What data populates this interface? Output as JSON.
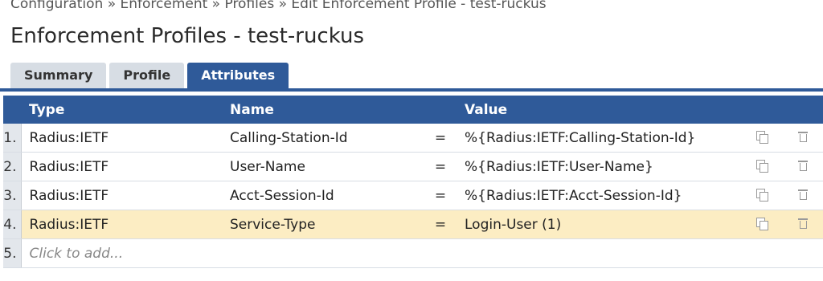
{
  "breadcrumb": "Configuration » Enforcement » Profiles » Edit Enforcement Profile - test-ruckus",
  "page_title": "Enforcement Profiles - test-ruckus",
  "tabs": [
    {
      "label": "Summary",
      "active": false
    },
    {
      "label": "Profile",
      "active": false
    },
    {
      "label": "Attributes",
      "active": true
    }
  ],
  "table": {
    "headers": {
      "type": "Type",
      "name": "Name",
      "value": "Value"
    },
    "rows": [
      {
        "num": "1.",
        "type": "Radius:IETF",
        "name": "Calling-Station-Id",
        "op": "=",
        "value": "%{Radius:IETF:Calling-Station-Id}"
      },
      {
        "num": "2.",
        "type": "Radius:IETF",
        "name": "User-Name",
        "op": "=",
        "value": "%{Radius:IETF:User-Name}"
      },
      {
        "num": "3.",
        "type": "Radius:IETF",
        "name": "Acct-Session-Id",
        "op": "=",
        "value": "%{Radius:IETF:Acct-Session-Id}"
      },
      {
        "num": "4.",
        "type": "Radius:IETF",
        "name": "Service-Type",
        "op": "=",
        "value": "Login-User (1)"
      }
    ],
    "add_row": {
      "num": "5.",
      "placeholder": "Click to add..."
    }
  },
  "icons": {
    "copy": "copy-icon",
    "delete": "trash-icon"
  },
  "colors": {
    "accent": "#2f5a99",
    "highlight_row": "#fcedc3",
    "tab_inactive": "#d7dde4"
  }
}
